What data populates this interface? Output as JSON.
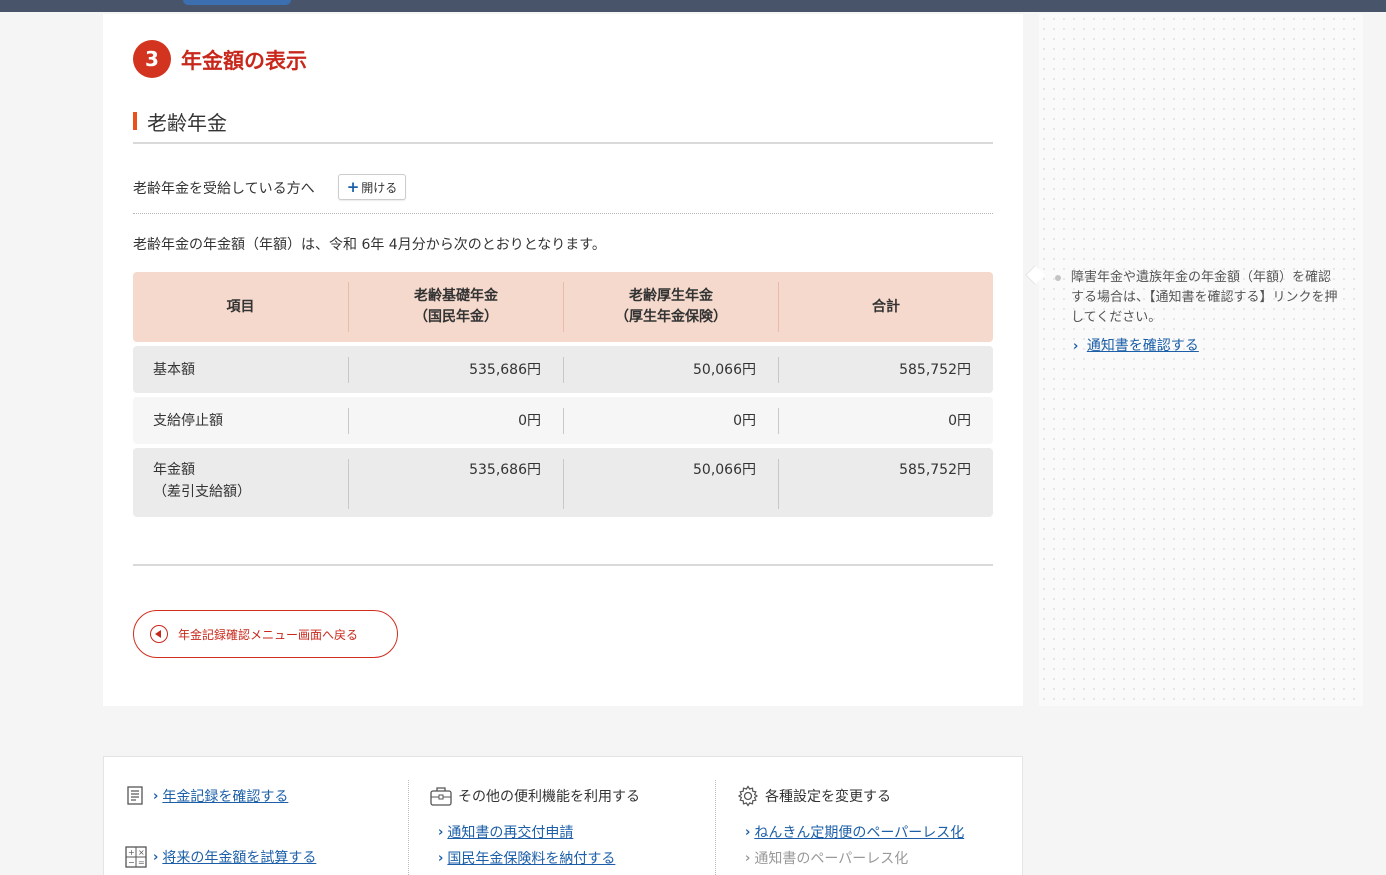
{
  "step": {
    "number": "3",
    "title": "年金額の表示"
  },
  "section": {
    "title": "老齢年金"
  },
  "recipient": {
    "text": "老齢年金を受給している方へ",
    "open_label": "開ける"
  },
  "description": "老齢年金の年金額（年額）は、令和 6年 4月分から次のとおりとなります。",
  "table": {
    "headers": [
      {
        "line1": "項目",
        "line2": ""
      },
      {
        "line1": "老齢基礎年金",
        "line2": "（国民年金）"
      },
      {
        "line1": "老齢厚生年金",
        "line2": "（厚生年金保険）"
      },
      {
        "line1": "合計",
        "line2": ""
      }
    ],
    "rows": [
      {
        "label1": "基本額",
        "label2": "",
        "c1": "535,686円",
        "c2": "50,066円",
        "c3": "585,752円"
      },
      {
        "label1": "支給停止額",
        "label2": "",
        "c1": "0円",
        "c2": "0円",
        "c3": "0円"
      },
      {
        "label1": "年金額",
        "label2": "（差引支給額）",
        "c1": "535,686円",
        "c2": "50,066円",
        "c3": "585,752円"
      }
    ]
  },
  "back_button": {
    "label": "年金記録確認メニュー画面へ戻る"
  },
  "side": {
    "note": "障害年金や遺族年金の年金額（年額）を確認する場合は、【通知書を確認する】リンクを押してください。",
    "link": "通知書を確認する"
  },
  "footer": {
    "col1": {
      "link1": "年金記録を確認する",
      "link2": "将来の年金額を試算する"
    },
    "col2": {
      "title": "その他の便利機能を利用する",
      "link1": "通知書の再交付申請",
      "link2": "国民年金保険料を納付する"
    },
    "col3": {
      "title": "各種設定を変更する",
      "link1": "ねんきん定期便のペーパーレス化",
      "item2": "通知書のペーパーレス化"
    }
  },
  "colors": {
    "accent_red": "#c8281b",
    "step_circle": "#d2341f",
    "header_bg": "#f4d9cc",
    "link_blue": "#1c5fa8"
  }
}
